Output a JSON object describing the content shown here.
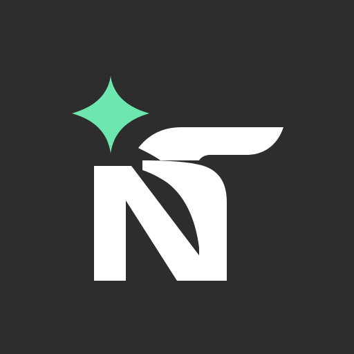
{
  "logo": {
    "lettering": "NT",
    "background_color": "#2d2d2d",
    "letter_color": "#ffffff",
    "sparkle_color": "#6ee6b0",
    "sparkle_icon": "four-point-star-icon"
  }
}
